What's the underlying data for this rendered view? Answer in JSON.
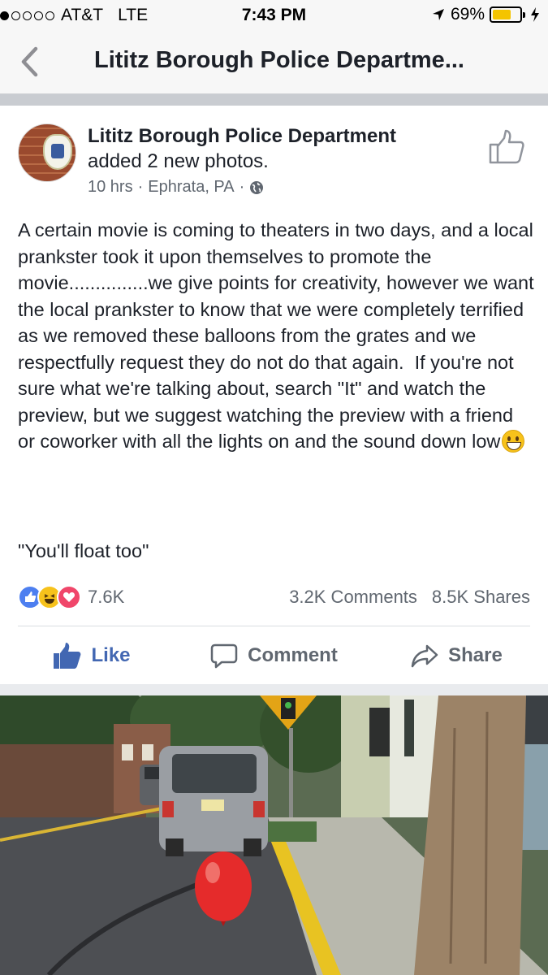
{
  "status": {
    "carrier": "AT&T",
    "network": "LTE",
    "time": "7:43 PM",
    "battery": "69%",
    "battery_level": 0.69,
    "signal_bars_filled": 1,
    "signal_bars_total": 5
  },
  "nav": {
    "title": "Lititz Borough Police Departme..."
  },
  "post": {
    "page_name": "Lititz Borough Police Department",
    "action": "added 2 new photos.",
    "time_ago": "10 hrs",
    "location": "Ephrata, PA",
    "body": "A certain movie is coming to theaters in two days, and a local prankster took it upon themselves to promote the movie...............we give points for creativity, however we want the local prankster to know that we were completely terrified as we removed these balloons from the grates and we respectfully request they do not do that again.  If you're not sure what we're talking about, search \"It\" and watch the preview, but we suggest watching the preview with a friend or coworker with all the lights on and the sound down low",
    "quote": "\"You'll float too\"",
    "reactions_count": "7.6K",
    "comments": "3.2K Comments",
    "shares": "8.5K Shares"
  },
  "actions": {
    "like": "Like",
    "comment": "Comment",
    "share": "Share"
  },
  "colors": {
    "facebook_blue": "#4267b2",
    "balloon_red": "#e52b2b",
    "curb_yellow": "#e8c322"
  },
  "icons": [
    "back-chevron-icon",
    "location-arrow-icon",
    "charging-bolt-icon",
    "globe-icon",
    "thumbs-up-icon",
    "comment-icon",
    "share-icon"
  ]
}
